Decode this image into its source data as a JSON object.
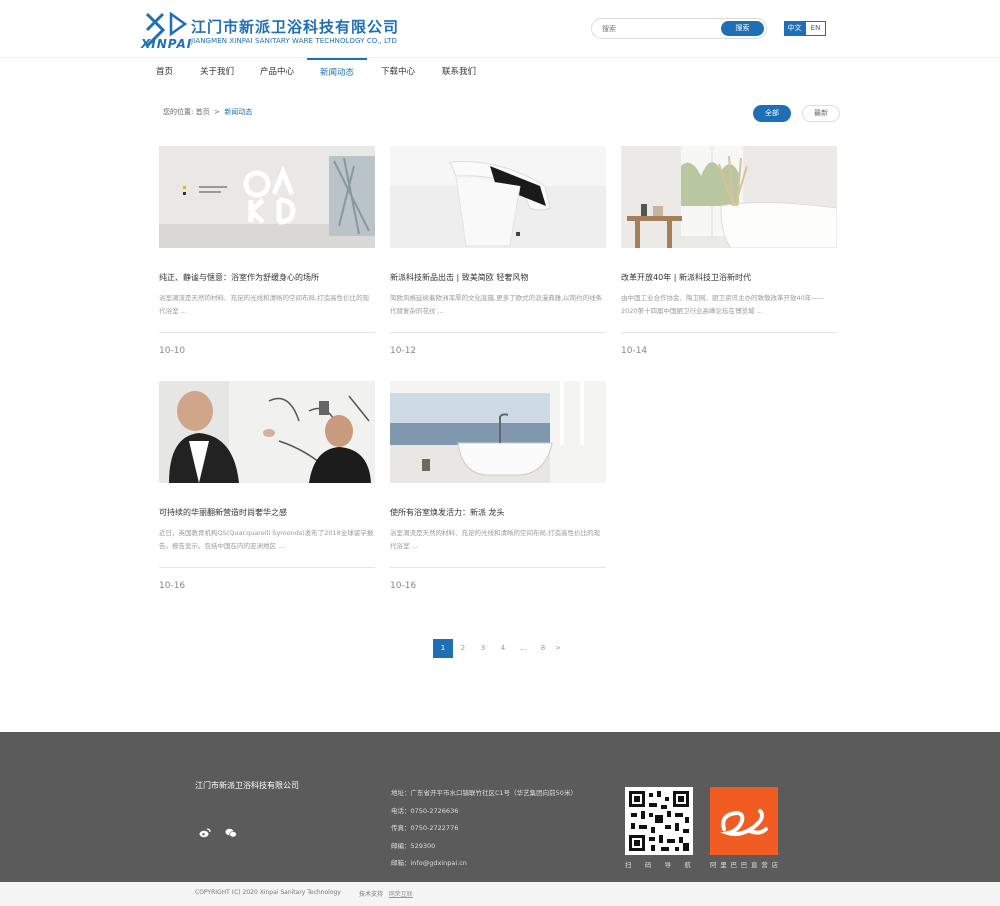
{
  "header": {
    "logo_cn": "江门市新派卫浴科技有限公司",
    "logo_en": "JIANGMEN XINPAI SANITARY WARE TECHNOLOGY CO., LTD",
    "logo_brand": "XINPAI",
    "search_placeholder": "搜索",
    "search_button": "搜索",
    "lang_cn": "中文",
    "lang_en": "EN",
    "brand_color": "#1f6fb7"
  },
  "nav": {
    "items": [
      {
        "label": "首页"
      },
      {
        "label": "关于我们"
      },
      {
        "label": "产品中心"
      },
      {
        "label": "新闻动态"
      },
      {
        "label": "下载中心"
      },
      {
        "label": "联系我们"
      }
    ],
    "active": "新闻动态"
  },
  "breadcrumb": {
    "prefix": "您的位置:",
    "home": "首页",
    "sep": ">",
    "current": "新闻动态"
  },
  "filters": {
    "all": "全部",
    "newest": "最新"
  },
  "articles": [
    {
      "title": "纯正、静谧与惬意：浴室作为舒缓身心的场所",
      "desc": "浴室潮流是天然的材料、充足的光线和清晰的空间布局,打造高性价比的现代浴室 ...",
      "date": "10-10",
      "image": "gallery-wall-photo"
    },
    {
      "title": "新派科技新品出击 | 致美简欧 轻奢风物",
      "desc": "简欧风格延续着欧洲浑厚的文化底蕴,更多了欧式的浪漫典雅,以简约的线条代替复杂的花纹 ...",
      "date": "10-12",
      "image": "faucet-photo"
    },
    {
      "title": "改革开放40年 | 新派科技卫浴新时代",
      "desc": "由中国工业合作协会、陶卫网、厨卫资讯主办的致敬改革开放40年——2020第十四届中国厨卫行业高峰论坛在博览城 ...",
      "date": "10-14",
      "image": "bathtub-interior-photo"
    },
    {
      "title": "可持续的华丽翻新营造时尚奢华之感",
      "desc": "近日，英国教育机构QS(Quacquarelli Symonds)发布了2018全球留学报告。报告显示，包括中国在内的亚洲地区 ...",
      "date": "10-16",
      "image": "designers-photo"
    },
    {
      "title": "使所有浴室焕发活力：新派 龙头",
      "desc": "浴室潮流是天然的材料、充足的光线和清晰的空间布局,打造高性价比的现代浴室 ...",
      "date": "10-16",
      "image": "seaside-bathtub-photo"
    }
  ],
  "pagination": {
    "pages": [
      "1",
      "2",
      "3",
      "4",
      "...",
      "8",
      ">"
    ],
    "current": "1"
  },
  "footer": {
    "company": "江门市新派卫浴科技有限公司",
    "address": "地址：广东省开平市水口镇联竹社区C1号（华艺集团向前50米）",
    "phone": "电话：0750-2726636",
    "fax": "传真：0750-2722776",
    "postcode": "邮编：529300",
    "email": "邮箱：info@gdxinpai.cn",
    "qr_label": "扫码导航",
    "ali_label": "阿里巴巴直营店",
    "copyright": "COPYRIGHT (C) 2020 Xinpai Sanitary Technology",
    "support_prefix": "技术支持",
    "support_link": "网荣互联"
  }
}
